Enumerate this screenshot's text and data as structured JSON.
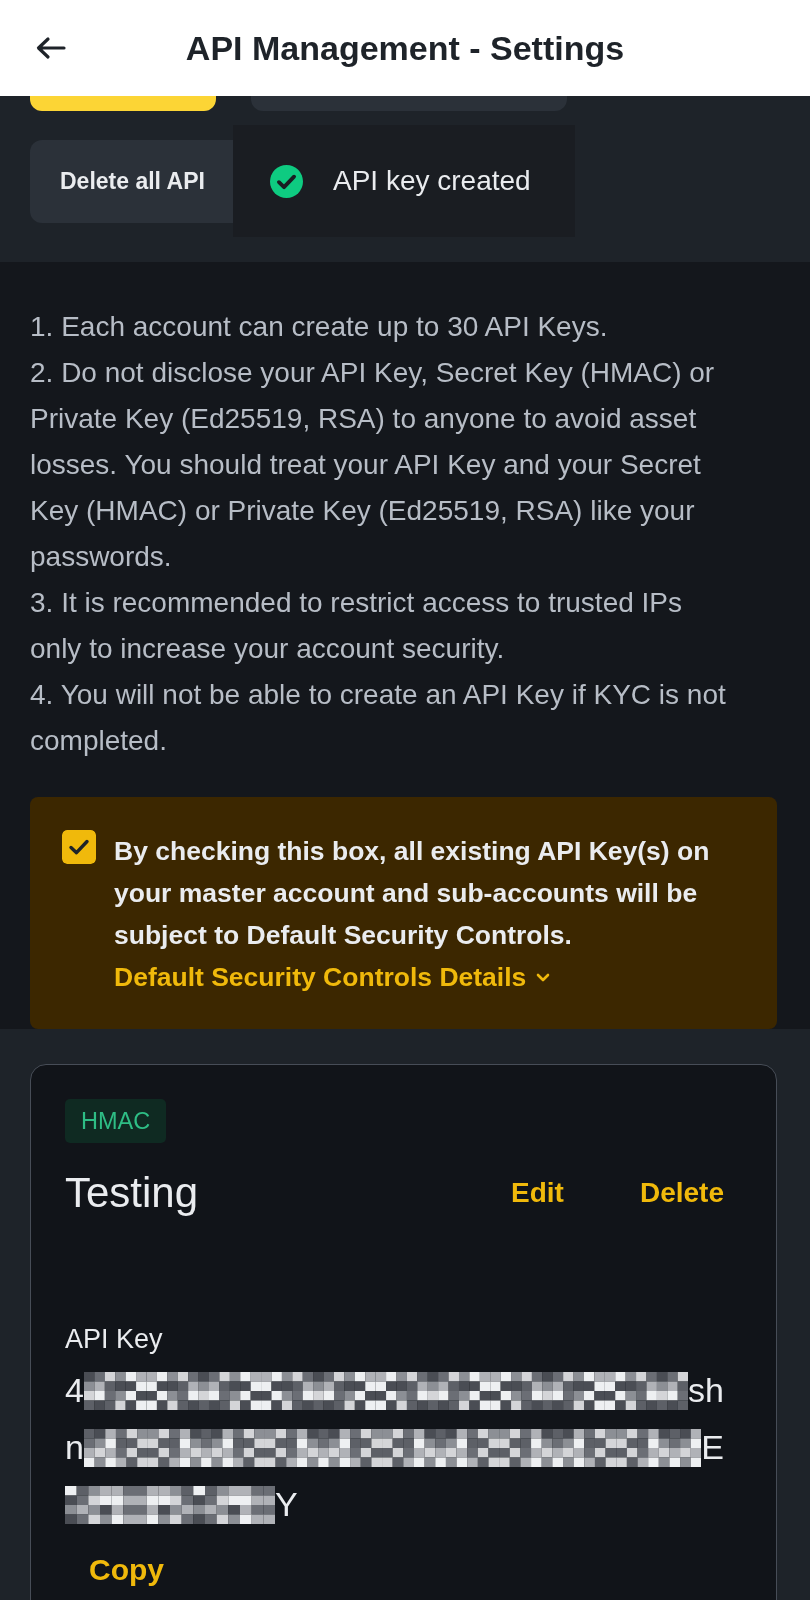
{
  "header": {
    "title": "API Management - Settings"
  },
  "top_buttons": [
    {
      "kind": "primary"
    },
    {
      "kind": "secondary"
    }
  ],
  "delete_all_button": {
    "label": "Delete all API"
  },
  "toast": {
    "kind": "success",
    "message": "API key created"
  },
  "notes": [
    "1. Each account can create up to 30 API Keys.",
    "2. Do not disclose your API Key, Secret Key (HMAC) or Private Key (Ed25519, RSA) to anyone to avoid asset losses. You should treat your API Key and your Secret Key (HMAC) or Private Key (Ed25519, RSA) like your passwords.",
    "3. It is recommended to restrict access to trusted IPs only to increase your account security.",
    "4. You will not be able to create an API Key if KYC is not completed."
  ],
  "consent": {
    "checked": true,
    "text": "By checking this box, all existing API Key(s) on your master account and sub-accounts will be subject to Default Security Controls.",
    "link": "Default Security Controls Details"
  },
  "api_key_card": {
    "badge": "HMAC",
    "name": "Testing",
    "actions": [
      "Edit",
      "Delete"
    ],
    "key_label": "API Key",
    "key_lines": [
      [
        {
          "kind": "text",
          "text": "4"
        },
        {
          "kind": "redacted"
        },
        {
          "kind": "text",
          "text": "sh"
        }
      ],
      [
        {
          "kind": "text",
          "text": "n"
        },
        {
          "kind": "redacted"
        },
        {
          "kind": "text",
          "text": "E"
        }
      ],
      [
        {
          "kind": "redacted"
        },
        {
          "kind": "text",
          "text": "Y"
        }
      ]
    ],
    "copy": "Copy"
  }
}
